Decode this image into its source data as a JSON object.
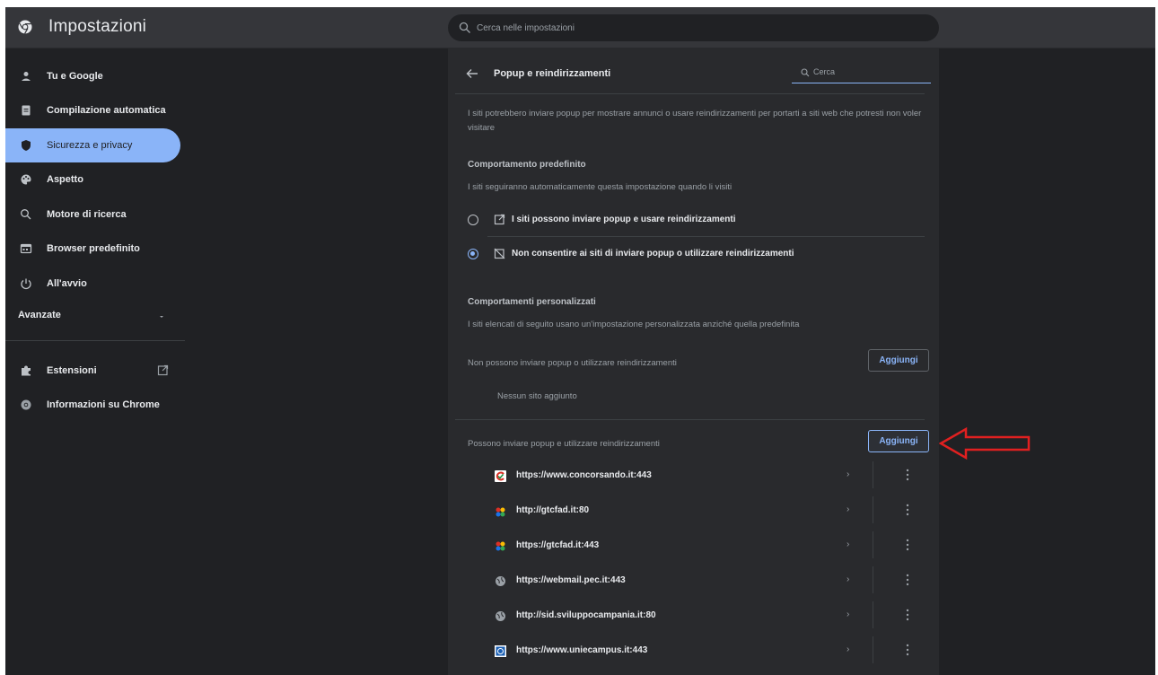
{
  "app": {
    "title": "Impostazioni"
  },
  "search": {
    "placeholder": "Cerca nelle impostazioni"
  },
  "sidebar": {
    "items": [
      {
        "label": "Tu e Google",
        "icon": "person-icon"
      },
      {
        "label": "Compilazione automatica",
        "icon": "clipboard-icon"
      },
      {
        "label": "Sicurezza e privacy",
        "icon": "shield-icon",
        "active": true
      },
      {
        "label": "Aspetto",
        "icon": "palette-icon"
      },
      {
        "label": "Motore di ricerca",
        "icon": "search-icon"
      },
      {
        "label": "Browser predefinito",
        "icon": "browser-icon"
      },
      {
        "label": "All'avvio",
        "icon": "power-icon"
      }
    ],
    "advanced": "Avanzate",
    "extensions": "Estensioni",
    "about": "Informazioni su Chrome"
  },
  "page": {
    "title": "Popup e reindirizzamenti",
    "search_placeholder": "Cerca",
    "description": "I siti potrebbero inviare popup per mostrare annunci o usare reindirizzamenti per portarti a siti web che potresti non voler visitare",
    "default_heading": "Comportamento predefinito",
    "default_sub": "I siti seguiranno automaticamente questa impostazione quando li visiti",
    "option_allow": "I siti possono inviare popup e usare reindirizzamenti",
    "option_block": "Non consentire ai siti di inviare popup o utilizzare reindirizzamenti",
    "selected_option": "block",
    "custom_heading": "Comportamenti personalizzati",
    "custom_sub": "I siti elencati di seguito usano un'impostazione personalizzata anziché quella predefinita",
    "blocked_heading": "Non possono inviare popup o utilizzare reindirizzamenti",
    "add_label": "Aggiungi",
    "no_sites": "Nessun sito aggiunto",
    "allowed_heading": "Possono inviare popup e utilizzare reindirizzamenti",
    "allowed_sites": [
      {
        "url": "https://www.concorsando.it:443",
        "icon": "concorsando-favicon"
      },
      {
        "url": "http://gtcfad.it:80",
        "icon": "gtcfad-favicon"
      },
      {
        "url": "https://gtcfad.it:443",
        "icon": "gtcfad-favicon"
      },
      {
        "url": "https://webmail.pec.it:443",
        "icon": "globe-icon"
      },
      {
        "url": "http://sid.sviluppocampania.it:80",
        "icon": "globe-icon"
      },
      {
        "url": "https://www.uniecampus.it:443",
        "icon": "uniecampus-favicon"
      }
    ]
  },
  "colors": {
    "accent": "#8ab4f8",
    "background": "#202124",
    "card": "#292a2d",
    "annotation": "#e02020"
  }
}
